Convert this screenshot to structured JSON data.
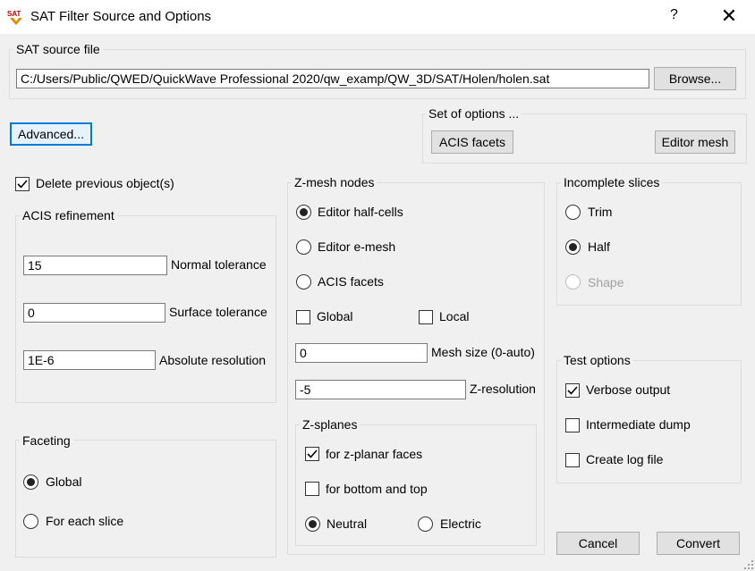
{
  "window": {
    "title": "SAT Filter Source and Options",
    "help": "?",
    "close": "✕",
    "icon": "sat-app-icon"
  },
  "source": {
    "group_title": "SAT source file",
    "path": "C:/Users/Public/QWED/QuickWave Professional 2020/qw_examp/QW_3D/SAT/Holen/holen.sat",
    "browse": "Browse..."
  },
  "advanced": "Advanced...",
  "set_of_options": {
    "title": "Set of options ...",
    "acis": "ACIS facets",
    "editor": "Editor mesh"
  },
  "delete_previous": {
    "label": "Delete previous object(s)",
    "checked": true
  },
  "acis_refinement": {
    "title": "ACIS refinement",
    "normal_value": "15",
    "normal_label": "Normal tolerance",
    "surface_value": "0",
    "surface_label": "Surface tolerance",
    "absolute_value": "1E-6",
    "absolute_label": "Absolute resolution"
  },
  "faceting": {
    "title": "Faceting",
    "global": "Global",
    "each": "For each slice",
    "selected": "global"
  },
  "zmesh": {
    "title": "Z-mesh nodes",
    "half": "Editor half-cells",
    "emesh": "Editor e-mesh",
    "acis": "ACIS facets",
    "selected": "half",
    "global": "Global",
    "local": "Local",
    "mesh_value": "0",
    "mesh_label": "Mesh size (0-auto)",
    "zres_value": "-5",
    "zres_label": "Z-resolution"
  },
  "zsplanes": {
    "title": "Z-splanes",
    "planar": "for z-planar faces",
    "planar_checked": true,
    "bottom": "for bottom and top",
    "bottom_checked": false,
    "neutral": "Neutral",
    "electric": "Electric",
    "selected": "neutral"
  },
  "incomplete": {
    "title": "Incomplete slices",
    "trim": "Trim",
    "half": "Half",
    "shape": "Shape",
    "selected": "half"
  },
  "test": {
    "title": "Test options",
    "verbose": "Verbose output",
    "verbose_checked": true,
    "dump": "Intermediate dump",
    "dump_checked": false,
    "log": "Create log file",
    "log_checked": false
  },
  "buttons": {
    "cancel": "Cancel",
    "convert": "Convert"
  }
}
